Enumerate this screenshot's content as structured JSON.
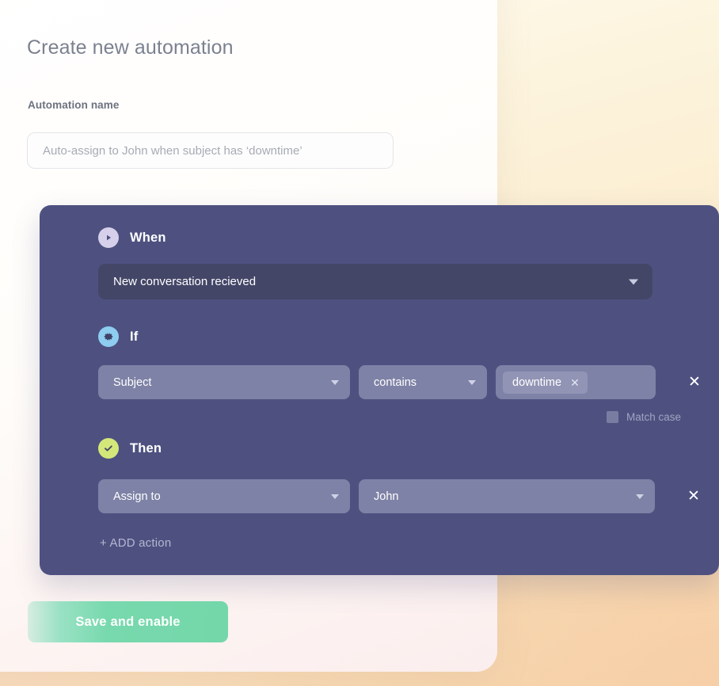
{
  "page": {
    "title": "Create new automation"
  },
  "form": {
    "name_label": "Automation name",
    "name_value": "",
    "name_placeholder": "Auto-assign to John when subject has ‘downtime’"
  },
  "panel": {
    "when": {
      "icon": "play-icon",
      "title": "When",
      "trigger_value": "New conversation recieved",
      "caret_icon": "chevron-down-icon"
    },
    "if": {
      "icon": "gear-icon",
      "title": "If",
      "field_value": "Subject",
      "operator_value": "contains",
      "tag_value": "downtime",
      "tag_remove_icon": "close-icon",
      "remove_icon": "close-icon",
      "match_case_label": "Match case",
      "match_case_checked": false
    },
    "then": {
      "icon": "check-icon",
      "title": "Then",
      "action_value": "Assign to",
      "target_value": "John",
      "remove_icon": "close-icon"
    },
    "add_action_label": "+ ADD action"
  },
  "footer": {
    "save_label": "Save and enable"
  },
  "colors": {
    "panel_bg": "#4e5180",
    "select_light": "#7e82a6",
    "trigger_bg": "#434667",
    "when_badge": "#d6d0ea",
    "if_badge": "#8ecdf0",
    "then_badge": "#d4e87a",
    "save_green": "#74d7aa",
    "title_gray": "#7c8190"
  }
}
